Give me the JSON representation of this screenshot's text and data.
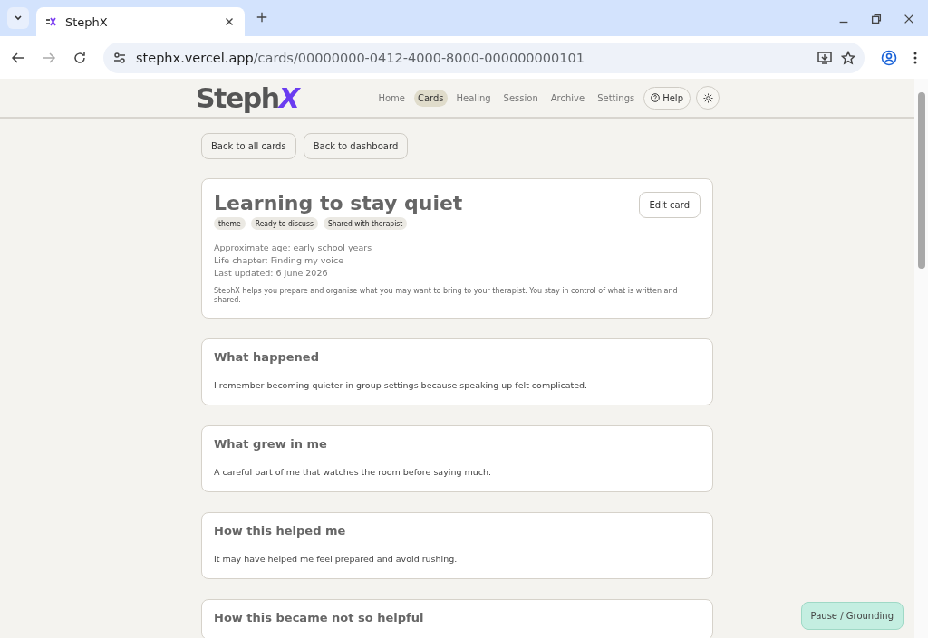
{
  "browser": {
    "tab_title": "StephX",
    "url_host": "stephx.vercel.app",
    "url_path": "/cards/00000000-0412-4000-8000-000000000101"
  },
  "header": {
    "logo_main": "Steph",
    "logo_accent": "X",
    "nav": [
      {
        "label": "Home",
        "selected": false
      },
      {
        "label": "Cards",
        "selected": true
      },
      {
        "label": "Healing",
        "selected": false
      },
      {
        "label": "Session",
        "selected": false
      },
      {
        "label": "Archive",
        "selected": false
      },
      {
        "label": "Settings",
        "selected": false
      }
    ],
    "help": "Help"
  },
  "back_buttons": [
    "Back to all cards",
    "Back to dashboard"
  ],
  "card": {
    "title": "Learning to stay quiet",
    "edit": "Edit card",
    "tags": [
      "theme",
      "Ready to discuss",
      "Shared with therapist"
    ],
    "meta": [
      "Approximate age: early school years",
      "Life chapter: Finding my voice",
      "Last updated: 6 June 2026"
    ],
    "note": "StephX helps you prepare and organise what you may want to bring to your therapist. You stay in control of what is written and shared."
  },
  "sections": [
    {
      "title": "What happened",
      "body": "I remember becoming quieter in group settings because speaking up felt complicated."
    },
    {
      "title": "What grew in me",
      "body": "A careful part of me that watches the room before saying much."
    },
    {
      "title": "How this helped me",
      "body": "It may have helped me feel prepared and avoid rushing."
    },
    {
      "title": "How this became not so helpful"
    }
  ],
  "pause_button": "Pause / Grounding"
}
